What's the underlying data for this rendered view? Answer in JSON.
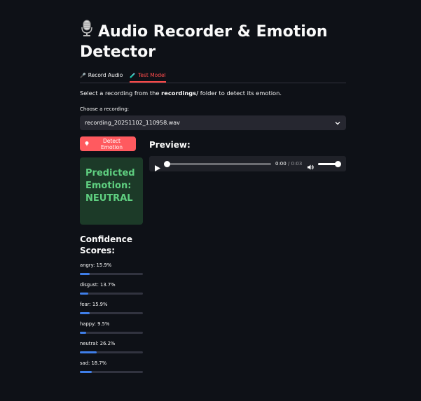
{
  "header": {
    "title": "Audio Recorder & Emotion Detector",
    "icon": "microphone-icon"
  },
  "tabs": [
    {
      "label": "Record Audio",
      "icon": "microphone-icon",
      "active": false
    },
    {
      "label": "Test Model",
      "icon": "pencil-icon",
      "active": true
    }
  ],
  "description": {
    "before": "Select a recording from the ",
    "bold": "recordings/",
    "after": " folder to detect its emotion."
  },
  "select": {
    "label": "Choose a recording:",
    "value": "recording_20251102_110958.wav"
  },
  "detect_button": {
    "label": "Detect Emotion",
    "icon": "sparkle-icon"
  },
  "prediction": {
    "text": "Predicted Emotion: NEUTRAL",
    "color": "#5fcf80",
    "bg": "#1c3a28"
  },
  "preview": {
    "title": "Preview:",
    "current_time": "0:00",
    "duration": "/ 0:03",
    "progress": 0,
    "volume": 1
  },
  "confidence": {
    "title": "Confidence Scores:",
    "scores": [
      {
        "label": "angry: 15.9%",
        "value": 15.9
      },
      {
        "label": "disgust: 13.7%",
        "value": 13.7
      },
      {
        "label": "fear: 15.9%",
        "value": 15.9
      },
      {
        "label": "happy: 9.5%",
        "value": 9.5
      },
      {
        "label": "neutral: 26.2%",
        "value": 26.2
      },
      {
        "label": "sad: 18.7%",
        "value": 18.7
      }
    ]
  },
  "colors": {
    "accent": "#ff4b4b",
    "bar": "#3f7ee8",
    "background": "#0e1117"
  }
}
